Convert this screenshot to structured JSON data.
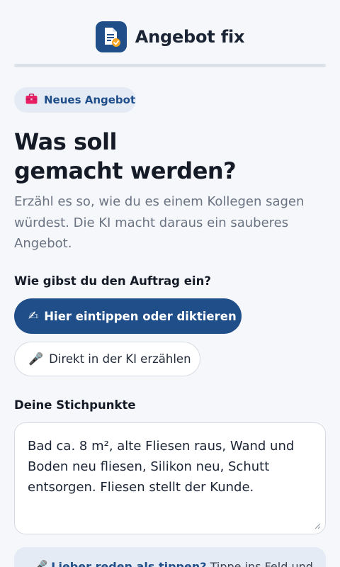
{
  "app": {
    "title": "Angebot fix",
    "logo_icon": "document-check-icon"
  },
  "chip": {
    "icon": "briefcase-icon",
    "label": "Neues Angebot"
  },
  "heading": {
    "line1": "Was soll",
    "line2": "gemacht werden?"
  },
  "subtitle": "Erzähl es so, wie du es einem Kollegen sagen würdest. Die KI macht daraus ein sauberes Angebot.",
  "input_mode": {
    "label": "Wie gibst du den Auftrag ein?",
    "options": [
      {
        "icon": "writing-hand-icon",
        "icon_glyph": "✍",
        "label": "Hier eintippen oder diktieren",
        "selected": true
      },
      {
        "icon": "microphone-icon",
        "icon_glyph": "🎤",
        "label": "Direkt in der KI erzählen",
        "selected": false
      }
    ]
  },
  "notes": {
    "label": "Deine Stichpunkte",
    "value": "Bad ca. 8 m², alte Fliesen raus, Wand und Boden neu fliesen, Silikon neu, Schutt entsorgen. Fliesen stellt der Kunde."
  },
  "tip": {
    "icon": "microphone-icon",
    "icon_glyph": "🎤",
    "link": "Lieber reden als tippen?",
    "text": "Tippe ins Feld und"
  },
  "colors": {
    "primary": "#1f4e89",
    "accent_badge": "#f5a524",
    "background": "#f6f7fa",
    "chip_bg": "#e4ebf4"
  }
}
